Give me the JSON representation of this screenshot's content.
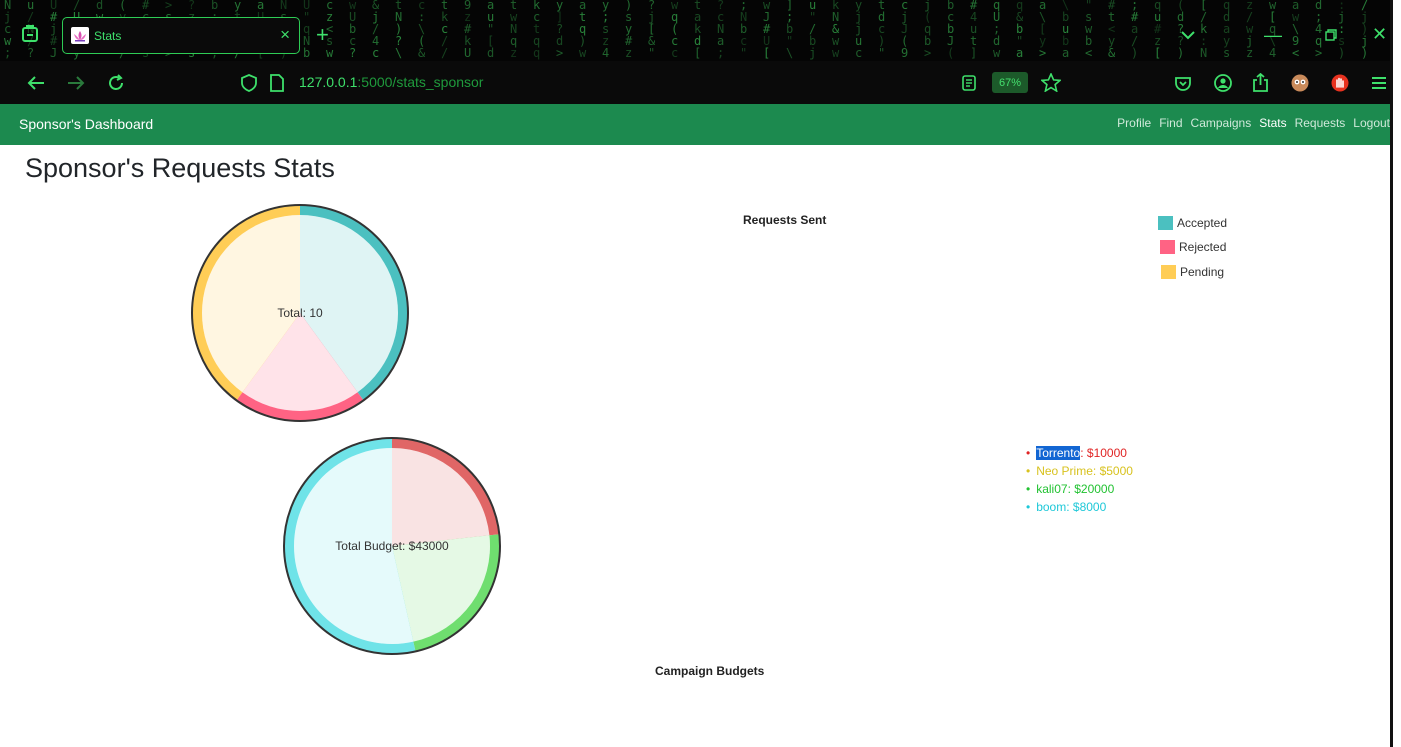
{
  "browser": {
    "tab_title": "Stats",
    "url_host": "127.0.0.1",
    "url_path": ":5000/stats_sponsor",
    "zoom": "67%"
  },
  "header": {
    "brand": "Sponsor's Dashboard",
    "nav": [
      "Profile",
      "Find",
      "Campaigns",
      "Stats",
      "Requests",
      "Logout"
    ],
    "active_nav": "Stats"
  },
  "page_title": "Sponsor's Requests Stats",
  "chart_data": [
    {
      "type": "pie",
      "title": "Requests Sent",
      "center_label": "Total: 10",
      "legend_placement": "top-right",
      "categories": [
        "Accepted",
        "Rejected",
        "Pending"
      ],
      "values": [
        4,
        2,
        4
      ],
      "colors": [
        "#4bc0c0",
        "#ff6384",
        "#ffcd56"
      ]
    },
    {
      "type": "pie",
      "title": "Campaign Budgets",
      "center_label": "Total Budget: $43000",
      "legend_placement": "right",
      "items": [
        {
          "name": "Torrento",
          "value": 10000,
          "label": "$10000",
          "color": "#e06666"
        },
        {
          "name": "Neo Prime",
          "value": 5000,
          "label": "$5000",
          "color": "#e6c13b"
        },
        {
          "name": "kali07",
          "value": 20000,
          "label": "$20000",
          "color": "#5cd65c"
        },
        {
          "name": "boom",
          "value": 8000,
          "label": "$8000",
          "color": "#4dd9e0"
        }
      ],
      "pie_colors": [
        "#e06666",
        "#6fde6f",
        "#6fe3e8"
      ]
    }
  ]
}
